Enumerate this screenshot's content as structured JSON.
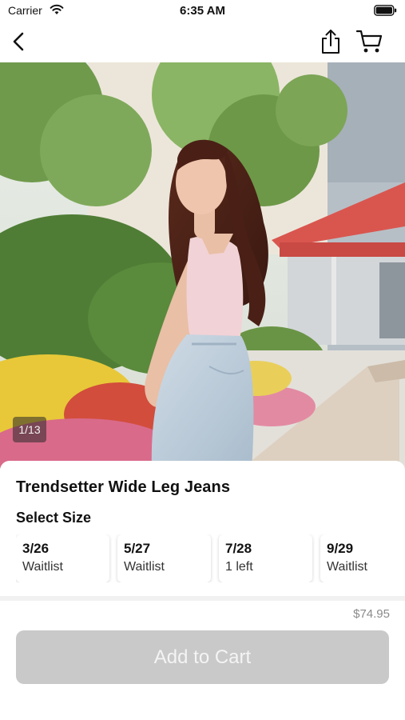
{
  "status_bar": {
    "carrier": "Carrier",
    "time": "6:35 AM"
  },
  "nav": {
    "back_icon": "chevron-left-icon",
    "share_icon": "share-icon",
    "cart_icon": "cart-icon"
  },
  "gallery": {
    "counter": "1/13"
  },
  "product": {
    "title": "Trendsetter Wide Leg Jeans",
    "select_size_label": "Select Size",
    "sizes": [
      {
        "size": "3/26",
        "status": "Waitlist"
      },
      {
        "size": "5/27",
        "status": "Waitlist"
      },
      {
        "size": "7/28",
        "status": "1 left"
      },
      {
        "size": "9/29",
        "status": "Waitlist"
      }
    ],
    "price": "$74.95"
  },
  "cta": {
    "add_to_cart_label": "Add to Cart"
  }
}
